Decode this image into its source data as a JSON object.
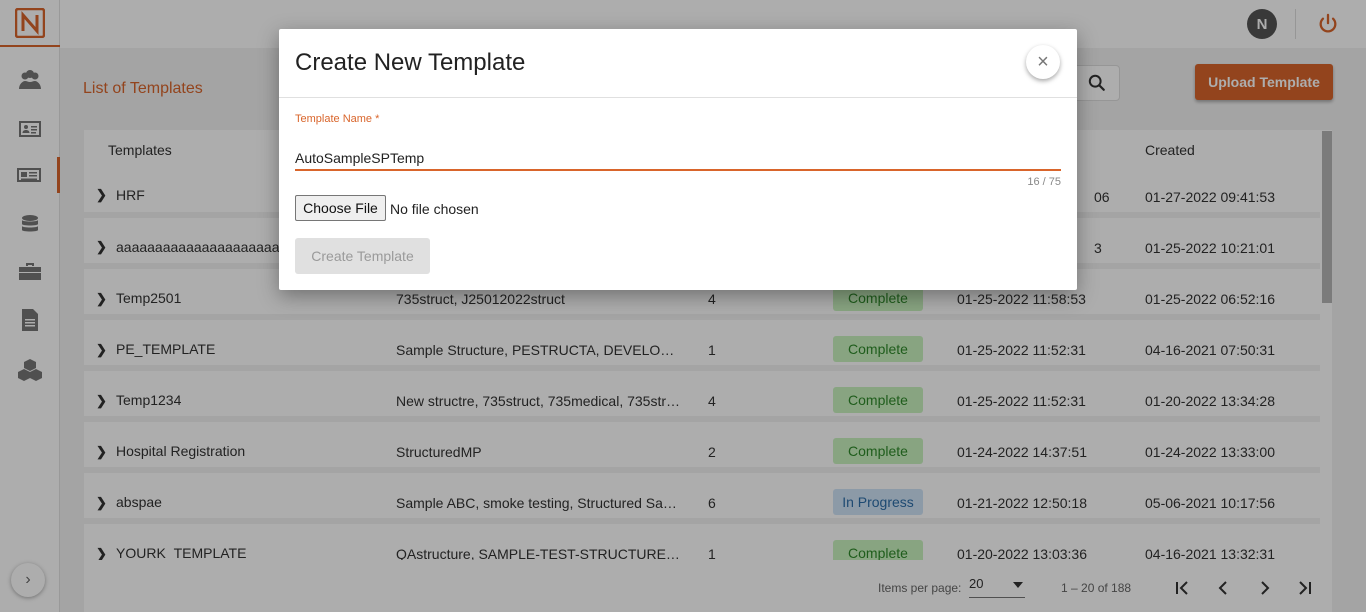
{
  "app": {
    "logo_letter": "N",
    "user_initial": "N"
  },
  "sidebar": {
    "items": [
      {
        "icon": "users-icon"
      },
      {
        "icon": "id-card-icon"
      },
      {
        "icon": "newspaper-icon",
        "active": true
      },
      {
        "icon": "database-icon"
      },
      {
        "icon": "briefcase-icon"
      },
      {
        "icon": "document-icon"
      },
      {
        "icon": "cubes-icon"
      }
    ],
    "expand_glyph": "›"
  },
  "page": {
    "title": "List of Templates",
    "upload_label": "Upload Template"
  },
  "table": {
    "headers": [
      "Templates",
      "Created"
    ],
    "rows": [
      {
        "name": "HRF",
        "structures": "",
        "count": "",
        "status": "",
        "modified": "06",
        "created": "01-27-2022 09:41:53"
      },
      {
        "name": "aaaaaaaaaaaaaaaaaaaaa",
        "structures": "",
        "count": "",
        "status": "",
        "modified": "3",
        "created": "01-25-2022 10:21:01"
      },
      {
        "name": "Temp2501",
        "structures": "735struct, J25012022struct",
        "count": "4",
        "status": "Complete",
        "modified": "01-25-2022 11:58:53",
        "created": "01-25-2022 06:52:16"
      },
      {
        "name": "PE_TEMPLATE",
        "structures": "Sample Structure, PESTRUCTA, DEVELO…",
        "count": "1",
        "status": "Complete",
        "modified": "01-25-2022 11:52:31",
        "created": "04-16-2021 07:50:31"
      },
      {
        "name": "Temp1234",
        "structures": "New structre, 735struct, 735medical, 735str…",
        "count": "4",
        "status": "Complete",
        "modified": "01-25-2022 11:52:31",
        "created": "01-20-2022 13:34:28"
      },
      {
        "name": "Hospital Registration",
        "structures": "StructuredMP",
        "count": "2",
        "status": "Complete",
        "modified": "01-24-2022 14:37:51",
        "created": "01-24-2022 13:33:00"
      },
      {
        "name": "abspae",
        "structures": "Sample ABC, smoke testing, Structured Sa…",
        "count": "6",
        "status": "In Progress",
        "modified": "01-21-2022 12:50:18",
        "created": "05-06-2021 10:17:56"
      },
      {
        "name": "YOURK_TEMPLATE",
        "structures": "QAstructure, SAMPLE-TEST-STRUCTURE…",
        "count": "1",
        "status": "Complete",
        "modified": "01-20-2022 13:03:36",
        "created": "04-16-2021 13:32:31"
      }
    ]
  },
  "paginator": {
    "items_per_page_label": "Items per page:",
    "page_size": "20",
    "range": "1 – 20 of 188"
  },
  "modal": {
    "title": "Create New Template",
    "close_glyph": "×",
    "field_label": "Template Name *",
    "field_value": "AutoSampleSPTemp",
    "counter": "16 / 75",
    "choose_file_label": "Choose File",
    "no_file_text": "No file chosen",
    "create_label": "Create Template"
  },
  "colors": {
    "accent": "#d9652b",
    "complete_bg": "#c9f2bf",
    "progress_bg": "#cfe3f7"
  }
}
